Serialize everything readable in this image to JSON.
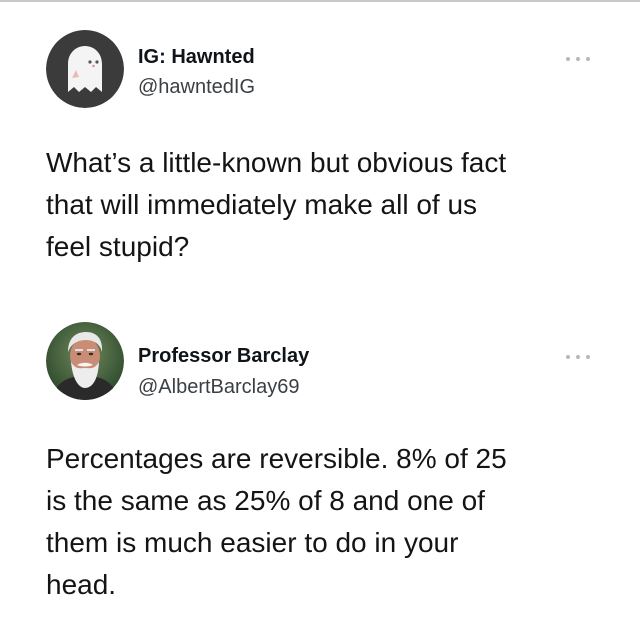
{
  "tweets": [
    {
      "author_name": "IG: Hawnted",
      "author_handle": "@hawntedIG",
      "avatar_icon": "ghost-icon",
      "text": "What’s a little-known but obvious fact\nthat will immediately make all of us\nfeel stupid?"
    },
    {
      "author_name": "Professor Barclay",
      "author_handle": "@AlbertBarclay69",
      "avatar_icon": "profile-photo",
      "text": "Percentages are reversible.  8% of 25\nis the same as 25% of 8 and one of\nthem is much easier to do in your\nhead."
    }
  ],
  "colors": {
    "text": "#0f1419",
    "handle": "#3a3f44",
    "more_dots": "#b5b9bd",
    "ghost_avatar_bg": "#3b3b3b"
  }
}
